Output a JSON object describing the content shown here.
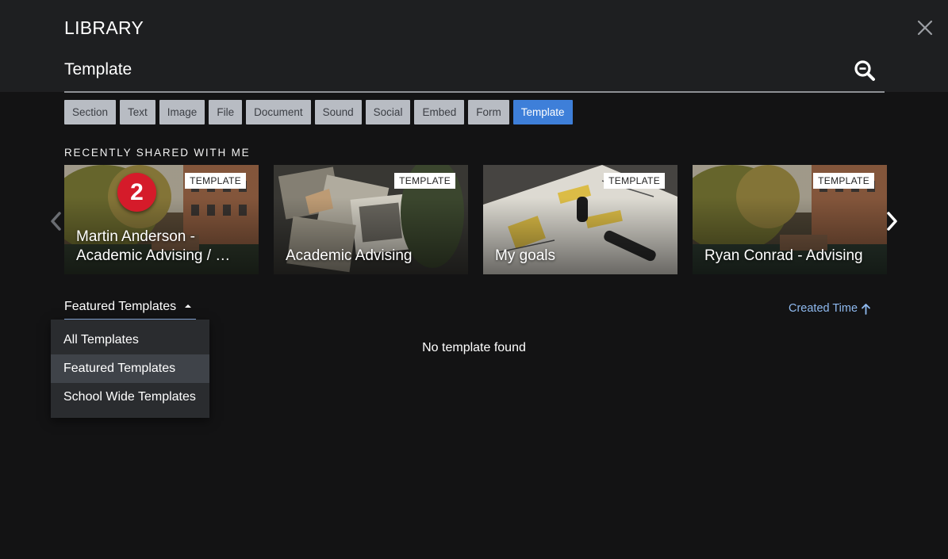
{
  "header": {
    "title": "LIBRARY",
    "close_icon": "close-icon",
    "search": {
      "value": "Template",
      "icon": "search-icon"
    }
  },
  "filters": [
    {
      "label": "Section",
      "active": false
    },
    {
      "label": "Text",
      "active": false
    },
    {
      "label": "Image",
      "active": false
    },
    {
      "label": "File",
      "active": false
    },
    {
      "label": "Document",
      "active": false
    },
    {
      "label": "Sound",
      "active": false
    },
    {
      "label": "Social",
      "active": false
    },
    {
      "label": "Embed",
      "active": false
    },
    {
      "label": "Form",
      "active": false
    },
    {
      "label": "Template",
      "active": true
    }
  ],
  "recent": {
    "label": "RECENTLY SHARED WITH ME",
    "step_number": "2",
    "cards": [
      {
        "title": "Martin Anderson - Academic Advising / …",
        "badge": "TEMPLATE"
      },
      {
        "title": "Academic Advising",
        "badge": "TEMPLATE"
      },
      {
        "title": "My goals",
        "badge": "TEMPLATE"
      },
      {
        "title": "Ryan Conrad - Advising",
        "badge": "TEMPLATE"
      }
    ]
  },
  "template_filter": {
    "selected": "Featured Templates",
    "options": [
      "All Templates",
      "Featured Templates",
      "School Wide Templates"
    ]
  },
  "sort": {
    "label": "Created Time",
    "icon": "arrow-up-icon"
  },
  "empty_message": "No template found",
  "colors": {
    "accent": "#3e7fd9",
    "badge_red": "#d51b2a",
    "link": "#8fbaf0"
  }
}
